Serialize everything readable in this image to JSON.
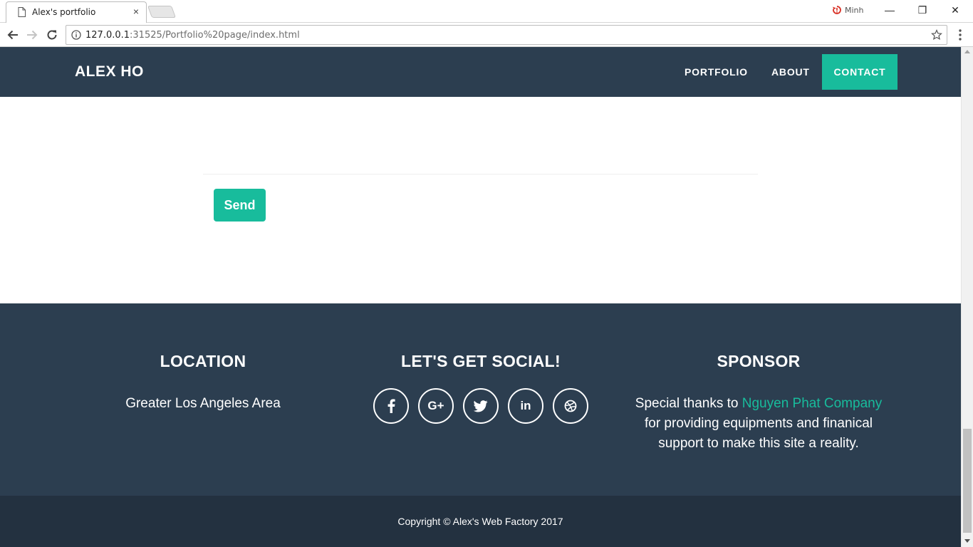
{
  "browser": {
    "tab_title": "Alex's portfolio",
    "tab_close": "×",
    "profile_name": "Minh",
    "url_host": "127.0.0.1",
    "url_rest": ":31525/Portfolio%20page/index.html",
    "window_minimize": "—",
    "window_restore": "❐",
    "window_close": "✕"
  },
  "navbar": {
    "brand": "ALEX HO",
    "links": [
      {
        "label": "PORTFOLIO"
      },
      {
        "label": "ABOUT"
      },
      {
        "label": "CONTACT",
        "active": true
      }
    ]
  },
  "contact_form": {
    "send_label": "Send"
  },
  "footer": {
    "location": {
      "title": "LOCATION",
      "text": "Greater Los Angeles Area"
    },
    "social": {
      "title": "LET'S GET SOCIAL!",
      "icons": [
        "facebook-icon",
        "google-plus-icon",
        "twitter-icon",
        "linkedin-icon",
        "dribbble-icon"
      ],
      "google_plus_glyph": "G+",
      "linkedin_glyph": "in"
    },
    "sponsor": {
      "title": "SPONSOR",
      "text_before": "Special thanks to ",
      "link_text": "Nguyen Phat Company",
      "text_after": " for providing equipments and finanical support to make this site a reality."
    },
    "copyright": "Copyright © Alex's Web Factory 2017"
  },
  "colors": {
    "navbar_bg": "#2c3e50",
    "accent": "#18bc9c",
    "footer_bottom_bg": "#233140",
    "text_light": "#ffffff"
  }
}
